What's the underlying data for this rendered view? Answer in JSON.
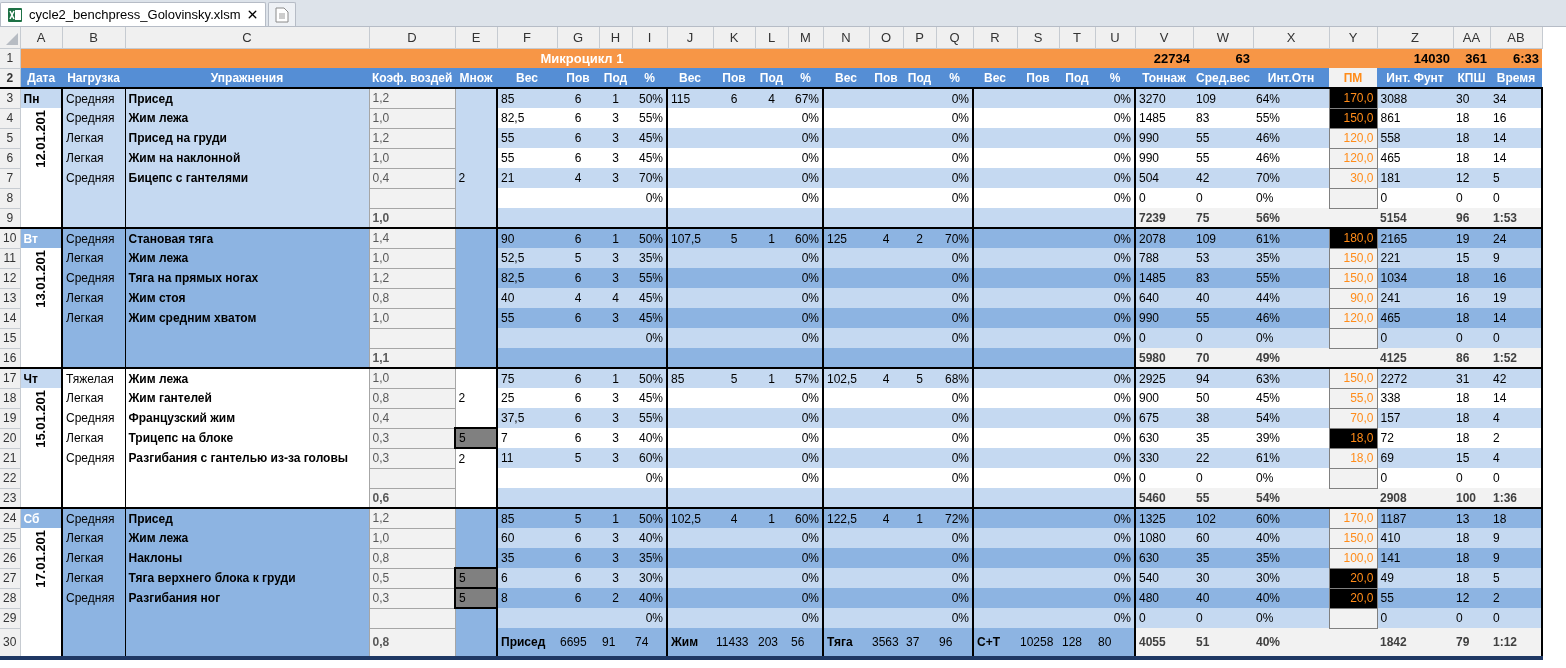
{
  "tabs": [
    {
      "kind": "file",
      "title": "cycle2_benchpress_Golovinsky.xlsm",
      "selected": true
    },
    {
      "kind": "new",
      "selected": false
    }
  ],
  "column_headers": [
    "A",
    "B",
    "C",
    "D",
    "E",
    "F",
    "G",
    "H",
    "I",
    "J",
    "K",
    "L",
    "M",
    "N",
    "O",
    "P",
    "Q",
    "R",
    "S",
    "T",
    "U",
    "V",
    "W",
    "X",
    "Y",
    "Z",
    "AA",
    "AB"
  ],
  "row_numbers": [
    "1",
    "2",
    "3",
    "4",
    "5",
    "6",
    "7",
    "8",
    "9",
    "10",
    "11",
    "12",
    "13",
    "14",
    "15",
    "16",
    "17",
    "18",
    "19",
    "20",
    "21",
    "22",
    "23",
    "24",
    "25",
    "26",
    "27",
    "28",
    "29",
    "30"
  ],
  "title_row": {
    "title": "Микроцикл 1",
    "tonnage": "22734",
    "avg_weight": "63",
    "int_funt": "14030",
    "kpsh": "361",
    "time": "6:33"
  },
  "header_row": [
    "Дата",
    "Нагрузка",
    "Упражнения",
    "Коэф. воздей",
    "Множ",
    "Вес",
    "Пов",
    "Под",
    "%",
    "Вес",
    "Пов",
    "Под",
    "%",
    "Вес",
    "Пов",
    "Под",
    "%",
    "Вес",
    "Пов",
    "Под",
    "%",
    "Тоннаж",
    "Сред.вес",
    "Инт.Отн",
    "ПМ",
    "Инт. Фунт",
    "КПШ",
    "Время"
  ],
  "days": [
    {
      "day": "Пн",
      "date": "12.01.201",
      "kind": "light",
      "exercises": [
        {
          "load": "Средняя",
          "name": "Присед",
          "coef": "1,2",
          "groups": [
            {
              "weight": "85",
              "reps": "6",
              "sets": "1",
              "pct": "50%"
            },
            {
              "weight": "115",
              "reps": "6",
              "sets": "4",
              "pct": "67%"
            },
            {
              "pct": "0%"
            },
            {
              "pct": "0%"
            }
          ],
          "tonnage": "3270",
          "avg": "109",
          "int_rel": "64%",
          "pm": "170,0",
          "pm_dark": true,
          "int_funt": "3088",
          "kpsh": "30",
          "time": "34"
        },
        {
          "load": "Средняя",
          "name": "Жим лежа",
          "coef": "1,0",
          "groups": [
            {
              "weight": "82,5",
              "reps": "6",
              "sets": "3",
              "pct": "55%"
            },
            {
              "pct": "0%"
            },
            {
              "pct": "0%"
            },
            {
              "pct": "0%"
            }
          ],
          "tonnage": "1485",
          "avg": "83",
          "int_rel": "55%",
          "pm": "150,0",
          "pm_dark": true,
          "int_funt": "861",
          "kpsh": "18",
          "time": "16"
        },
        {
          "load": "Легкая",
          "name": "Присед на груди",
          "coef": "1,2",
          "groups": [
            {
              "weight": "55",
              "reps": "6",
              "sets": "3",
              "pct": "45%"
            },
            {
              "pct": "0%"
            },
            {
              "pct": "0%"
            },
            {
              "pct": "0%"
            }
          ],
          "tonnage": "990",
          "avg": "55",
          "int_rel": "46%",
          "pm": "120,0",
          "pm_dark": false,
          "int_funt": "558",
          "kpsh": "18",
          "time": "14"
        },
        {
          "load": "Легкая",
          "name": "Жим на наклонной",
          "coef": "1,0",
          "groups": [
            {
              "weight": "55",
              "reps": "6",
              "sets": "3",
              "pct": "45%"
            },
            {
              "pct": "0%"
            },
            {
              "pct": "0%"
            },
            {
              "pct": "0%"
            }
          ],
          "tonnage": "990",
          "avg": "55",
          "int_rel": "46%",
          "pm": "120,0",
          "pm_dark": false,
          "int_funt": "465",
          "kpsh": "18",
          "time": "14"
        },
        {
          "load": "Средняя",
          "name": "Бицепс с гантелями",
          "coef": "0,4",
          "mult": "2",
          "mult_flagged": false,
          "groups": [
            {
              "weight": "21",
              "reps": "4",
              "sets": "3",
              "pct": "70%"
            },
            {
              "pct": "0%"
            },
            {
              "pct": "0%"
            },
            {
              "pct": "0%"
            }
          ],
          "tonnage": "504",
          "avg": "42",
          "int_rel": "70%",
          "pm": "30,0",
          "pm_dark": false,
          "int_funt": "181",
          "kpsh": "12",
          "time": "5"
        }
      ],
      "blank_row": {
        "pcts": [
          "0%",
          "0%",
          "0%",
          "0%"
        ],
        "tonnage": "0",
        "avg": "0",
        "int_rel": "0%",
        "int_funt": "0",
        "kpsh": "0",
        "time": "0"
      },
      "total": {
        "coef": "1,0",
        "tonnage": "7239",
        "avg": "75",
        "int_rel": "56%",
        "int_funt": "5154",
        "kpsh": "96",
        "time": "1:53"
      }
    },
    {
      "day": "Вт",
      "date": "13.01.201",
      "kind": "medium",
      "exercises": [
        {
          "load": "Средняя",
          "name": "Становая тяга",
          "coef": "1,4",
          "groups": [
            {
              "weight": "90",
              "reps": "6",
              "sets": "1",
              "pct": "50%"
            },
            {
              "weight": "107,5",
              "reps": "5",
              "sets": "1",
              "pct": "60%"
            },
            {
              "weight": "125",
              "reps": "4",
              "sets": "2",
              "pct": "70%"
            },
            {
              "pct": "0%"
            }
          ],
          "tonnage": "2078",
          "avg": "109",
          "int_rel": "61%",
          "pm": "180,0",
          "pm_dark": true,
          "int_funt": "2165",
          "kpsh": "19",
          "time": "24"
        },
        {
          "load": "Легкая",
          "name": "Жим лежа",
          "coef": "1,0",
          "groups": [
            {
              "weight": "52,5",
              "reps": "5",
              "sets": "3",
              "pct": "35%"
            },
            {
              "pct": "0%"
            },
            {
              "pct": "0%"
            },
            {
              "pct": "0%"
            }
          ],
          "tonnage": "788",
          "avg": "53",
          "int_rel": "35%",
          "pm": "150,0",
          "pm_dark": false,
          "int_funt": "221",
          "kpsh": "15",
          "time": "9"
        },
        {
          "load": "Средняя",
          "name": "Тяга на прямых ногах",
          "coef": "1,2",
          "groups": [
            {
              "weight": "82,5",
              "reps": "6",
              "sets": "3",
              "pct": "55%"
            },
            {
              "pct": "0%"
            },
            {
              "pct": "0%"
            },
            {
              "pct": "0%"
            }
          ],
          "tonnage": "1485",
          "avg": "83",
          "int_rel": "55%",
          "pm": "150,0",
          "pm_dark": false,
          "int_funt": "1034",
          "kpsh": "18",
          "time": "16"
        },
        {
          "load": "Легкая",
          "name": "Жим стоя",
          "coef": "0,8",
          "groups": [
            {
              "weight": "40",
              "reps": "4",
              "sets": "4",
              "pct": "45%"
            },
            {
              "pct": "0%"
            },
            {
              "pct": "0%"
            },
            {
              "pct": "0%"
            }
          ],
          "tonnage": "640",
          "avg": "40",
          "int_rel": "44%",
          "pm": "90,0",
          "pm_dark": false,
          "int_funt": "241",
          "kpsh": "16",
          "time": "19"
        },
        {
          "load": "Легкая",
          "name": "Жим средним хватом",
          "coef": "1,0",
          "groups": [
            {
              "weight": "55",
              "reps": "6",
              "sets": "3",
              "pct": "45%"
            },
            {
              "pct": "0%"
            },
            {
              "pct": "0%"
            },
            {
              "pct": "0%"
            }
          ],
          "tonnage": "990",
          "avg": "55",
          "int_rel": "46%",
          "pm": "120,0",
          "pm_dark": false,
          "int_funt": "465",
          "kpsh": "18",
          "time": "14"
        }
      ],
      "blank_row": {
        "pcts": [
          "0%",
          "0%",
          "0%",
          "0%"
        ],
        "tonnage": "0",
        "avg": "0",
        "int_rel": "0%",
        "int_funt": "0",
        "kpsh": "0",
        "time": "0"
      },
      "total": {
        "coef": "1,1",
        "tonnage": "5980",
        "avg": "70",
        "int_rel": "49%",
        "int_funt": "4125",
        "kpsh": "86",
        "time": "1:52"
      }
    },
    {
      "day": "Чт",
      "date": "15.01.201",
      "kind": "plain",
      "exercises": [
        {
          "load": "Тяжелая",
          "name": "Жим лежа",
          "coef": "1,0",
          "groups": [
            {
              "weight": "75",
              "reps": "6",
              "sets": "1",
              "pct": "50%"
            },
            {
              "weight": "85",
              "reps": "5",
              "sets": "1",
              "pct": "57%"
            },
            {
              "weight": "102,5",
              "reps": "4",
              "sets": "5",
              "pct": "68%"
            },
            {
              "pct": "0%"
            }
          ],
          "tonnage": "2925",
          "avg": "94",
          "int_rel": "63%",
          "pm": "150,0",
          "pm_dark": false,
          "int_funt": "2272",
          "kpsh": "31",
          "time": "42"
        },
        {
          "load": "Легкая",
          "name": "Жим гантелей",
          "coef": "0,8",
          "mult": "2",
          "mult_flagged": false,
          "groups": [
            {
              "weight": "25",
              "reps": "6",
              "sets": "3",
              "pct": "45%"
            },
            {
              "pct": "0%"
            },
            {
              "pct": "0%"
            },
            {
              "pct": "0%"
            }
          ],
          "tonnage": "900",
          "avg": "50",
          "int_rel": "45%",
          "pm": "55,0",
          "pm_dark": false,
          "int_funt": "338",
          "kpsh": "18",
          "time": "14"
        },
        {
          "load": "Средняя",
          "name": "Французский жим",
          "coef": "0,4",
          "groups": [
            {
              "weight": "37,5",
              "reps": "6",
              "sets": "3",
              "pct": "55%"
            },
            {
              "pct": "0%"
            },
            {
              "pct": "0%"
            },
            {
              "pct": "0%"
            }
          ],
          "tonnage": "675",
          "avg": "38",
          "int_rel": "54%",
          "pm": "70,0",
          "pm_dark": false,
          "int_funt": "157",
          "kpsh": "18",
          "time": "4"
        },
        {
          "load": "Легкая",
          "name": "Трицепс на блоке",
          "coef": "0,3",
          "mult": "5",
          "mult_flagged": true,
          "groups": [
            {
              "weight": "7",
              "reps": "6",
              "sets": "3",
              "pct": "40%"
            },
            {
              "pct": "0%"
            },
            {
              "pct": "0%"
            },
            {
              "pct": "0%"
            }
          ],
          "tonnage": "630",
          "avg": "35",
          "int_rel": "39%",
          "pm": "18,0",
          "pm_dark": true,
          "int_funt": "72",
          "kpsh": "18",
          "time": "2"
        },
        {
          "load": "Средняя",
          "name": "Разгибания с гантелью из-за головы",
          "coef": "0,3",
          "mult": "2",
          "mult_flagged": false,
          "groups": [
            {
              "weight": "11",
              "reps": "5",
              "sets": "3",
              "pct": "60%"
            },
            {
              "pct": "0%"
            },
            {
              "pct": "0%"
            },
            {
              "pct": "0%"
            }
          ],
          "tonnage": "330",
          "avg": "22",
          "int_rel": "61%",
          "pm": "18,0",
          "pm_dark": false,
          "int_funt": "69",
          "kpsh": "15",
          "time": "4"
        }
      ],
      "blank_row": {
        "pcts": [
          "0%",
          "0%",
          "0%",
          "0%"
        ],
        "tonnage": "0",
        "avg": "0",
        "int_rel": "0%",
        "int_funt": "0",
        "kpsh": "0",
        "time": "0"
      },
      "total": {
        "coef": "0,6",
        "tonnage": "5460",
        "avg": "55",
        "int_rel": "54%",
        "int_funt": "2908",
        "kpsh": "100",
        "time": "1:36"
      }
    },
    {
      "day": "Сб",
      "date": "17.01.201",
      "kind": "medium",
      "exercises": [
        {
          "load": "Средняя",
          "name": "Присед",
          "coef": "1,2",
          "groups": [
            {
              "weight": "85",
              "reps": "5",
              "sets": "1",
              "pct": "50%"
            },
            {
              "weight": "102,5",
              "reps": "4",
              "sets": "1",
              "pct": "60%"
            },
            {
              "weight": "122,5",
              "reps": "4",
              "sets": "1",
              "pct": "72%"
            },
            {
              "pct": "0%"
            }
          ],
          "tonnage": "1325",
          "avg": "102",
          "int_rel": "60%",
          "pm": "170,0",
          "pm_dark": false,
          "int_funt": "1187",
          "kpsh": "13",
          "time": "18"
        },
        {
          "load": "Легкая",
          "name": "Жим лежа",
          "coef": "1,0",
          "groups": [
            {
              "weight": "60",
              "reps": "6",
              "sets": "3",
              "pct": "40%"
            },
            {
              "pct": "0%"
            },
            {
              "pct": "0%"
            },
            {
              "pct": "0%"
            }
          ],
          "tonnage": "1080",
          "avg": "60",
          "int_rel": "40%",
          "pm": "150,0",
          "pm_dark": false,
          "int_funt": "410",
          "kpsh": "18",
          "time": "9"
        },
        {
          "load": "Легкая",
          "name": "Наклоны",
          "coef": "0,8",
          "groups": [
            {
              "weight": "35",
              "reps": "6",
              "sets": "3",
              "pct": "35%"
            },
            {
              "pct": "0%"
            },
            {
              "pct": "0%"
            },
            {
              "pct": "0%"
            }
          ],
          "tonnage": "630",
          "avg": "35",
          "int_rel": "35%",
          "pm": "100,0",
          "pm_dark": false,
          "int_funt": "141",
          "kpsh": "18",
          "time": "9"
        },
        {
          "load": "Легкая",
          "name": "Тяга верхнего блока к груди",
          "coef": "0,5",
          "mult": "5",
          "mult_flagged": true,
          "groups": [
            {
              "weight": "6",
              "reps": "6",
              "sets": "3",
              "pct": "30%"
            },
            {
              "pct": "0%"
            },
            {
              "pct": "0%"
            },
            {
              "pct": "0%"
            }
          ],
          "tonnage": "540",
          "avg": "30",
          "int_rel": "30%",
          "pm": "20,0",
          "pm_dark": true,
          "int_funt": "49",
          "kpsh": "18",
          "time": "5"
        },
        {
          "load": "Средняя",
          "name": "Разгибания ног",
          "coef": "0,3",
          "mult": "5",
          "mult_flagged": true,
          "groups": [
            {
              "weight": "8",
              "reps": "6",
              "sets": "2",
              "pct": "40%"
            },
            {
              "pct": "0%"
            },
            {
              "pct": "0%"
            },
            {
              "pct": "0%"
            }
          ],
          "tonnage": "480",
          "avg": "40",
          "int_rel": "40%",
          "pm": "20,0",
          "pm_dark": true,
          "int_funt": "55",
          "kpsh": "12",
          "time": "2"
        }
      ],
      "blank_row": {
        "pcts": [
          "0%",
          "0%",
          "0%",
          "0%"
        ],
        "tonnage": "0",
        "avg": "0",
        "int_rel": "0%",
        "int_funt": "0",
        "kpsh": "0",
        "time": "0"
      },
      "total": {
        "coef": "0,8",
        "tonnage": "4055",
        "avg": "51",
        "int_rel": "40%",
        "int_funt": "1842",
        "kpsh": "79",
        "time": "1:12",
        "lifts": [
          {
            "name": "Присед",
            "values": [
              "6695",
              "91",
              "74"
            ]
          },
          {
            "name": "Жим",
            "values": [
              "11433",
              "203",
              "56"
            ]
          },
          {
            "name": "Тяга",
            "values": [
              "3563",
              "37",
              "96"
            ]
          },
          {
            "name": "С+Т",
            "values": [
              "10258",
              "128",
              "80"
            ]
          }
        ]
      }
    }
  ]
}
